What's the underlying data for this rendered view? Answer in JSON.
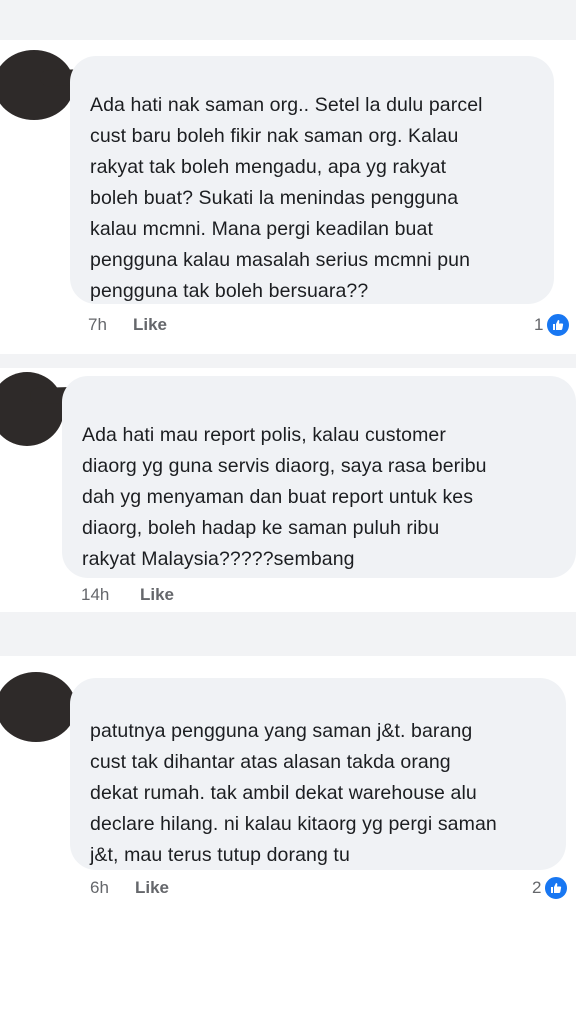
{
  "comments": [
    {
      "text": "Ada hati nak saman org..  Setel la dulu parcel\ncust baru boleh fikir nak saman org. Kalau\nrakyat tak boleh mengadu,  apa yg rakyat\nboleh buat? Sukati la menindas pengguna\nkalau mcmni. Mana pergi keadilan buat\npengguna kalau masalah serius mcmni pun\npengguna tak boleh bersuara??",
      "time": "7h",
      "like_label": "Like",
      "reaction_count": "1"
    },
    {
      "text": "Ada hati mau report polis, kalau customer\ndiaorg yg guna servis diaorg, saya rasa beribu\ndah yg menyaman dan buat report untuk kes\ndiaorg, boleh hadap ke saman puluh ribu\nrakyat Malaysia?????sembang",
      "time": "14h",
      "like_label": "Like"
    },
    {
      "text": "patutnya pengguna yang saman j&t. barang\ncust tak dihantar atas alasan takda orang\ndekat rumah. tak ambil dekat warehouse alu\ndeclare hilang. ni kalau kitaorg yg pergi saman\nj&t, mau terus tutup dorang tu",
      "time": "6h",
      "like_label": "Like",
      "reaction_count": "2"
    }
  ],
  "colors": {
    "like_badge": "#1877f2",
    "bubble": "#f0f2f5",
    "meta_text": "#65676b",
    "separator": "#f2f3f5"
  },
  "icons": [
    "thumbs-up-icon"
  ]
}
